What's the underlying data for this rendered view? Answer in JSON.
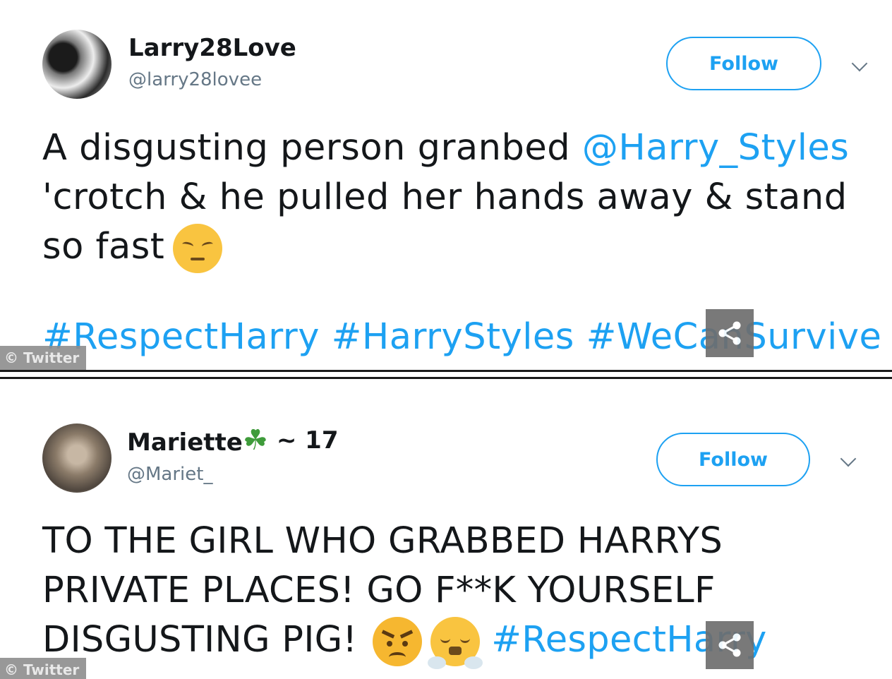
{
  "tweets": [
    {
      "display_name": "Larry28Love",
      "handle": "@larry28lovee",
      "follow_label": "Follow",
      "text_lines": [
        {
          "pre": "A disgusting person granbed ",
          "mention": "@Harry_Styles"
        },
        {
          "text": "'crotch & he pulled her hands away & stand"
        },
        {
          "text": "so fast",
          "emoji": "pensive-face"
        }
      ],
      "hashtags": "#RespectHarry #HarryStyles #WeCanSurvive",
      "watermark": "© Twitter"
    },
    {
      "display_name": "Mariette",
      "name_emoji": "four-leaf-clover",
      "name_suffix": "~ 17",
      "handle": "@Mariet_",
      "follow_label": "Follow",
      "text_lines": [
        {
          "text": "TO THE GIRL WHO GRABBED HARRYS"
        },
        {
          "text": "PRIVATE PLACES! GO F**K YOURSELF"
        },
        {
          "pre": "DISGUSTING PIG!",
          "emojis": [
            "angry-face",
            "face-with-steam"
          ],
          "hashtag": "#RespectHarry"
        }
      ],
      "watermark": "© Twitter"
    }
  ],
  "colors": {
    "link": "#1da1f2",
    "text": "#14171a",
    "handle": "#657786"
  },
  "icons": [
    "chevron-down-icon",
    "share-icon"
  ]
}
